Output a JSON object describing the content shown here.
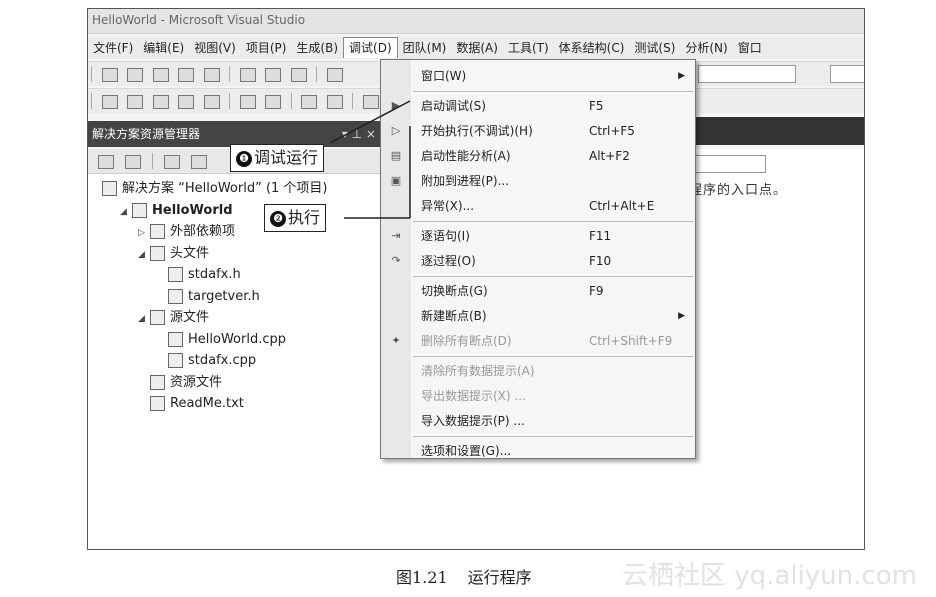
{
  "window": {
    "title": "HelloWorld - Microsoft Visual Studio"
  },
  "menubar": {
    "items": [
      "文件(F)",
      "编辑(E)",
      "视图(V)",
      "项目(P)",
      "生成(B)",
      "调试(D)",
      "团队(M)",
      "数据(A)",
      "工具(T)",
      "体系结构(C)",
      "测试(S)",
      "分析(N)",
      "窗口"
    ]
  },
  "solution_explorer": {
    "title": "解决方案资源管理器",
    "pin": "▾ ⊥ ×",
    "tree": [
      {
        "label": "解决方案 “HelloWorld” (1 个项目)",
        "icon": "solution-icon",
        "indent": 0,
        "arrow": ""
      },
      {
        "label": "HelloWorld",
        "icon": "project-icon",
        "indent": 1,
        "arrow": "◢",
        "bold": true
      },
      {
        "label": "外部依赖项",
        "icon": "external-deps-icon",
        "indent": 2,
        "arrow": "▷"
      },
      {
        "label": "头文件",
        "icon": "folder-icon",
        "indent": 2,
        "arrow": "◢"
      },
      {
        "label": "stdafx.h",
        "icon": "header-file-icon",
        "indent": 3,
        "arrow": ""
      },
      {
        "label": "targetver.h",
        "icon": "header-file-icon",
        "indent": 3,
        "arrow": ""
      },
      {
        "label": "源文件",
        "icon": "folder-icon",
        "indent": 2,
        "arrow": "◢"
      },
      {
        "label": "HelloWorld.cpp",
        "icon": "cpp-file-icon",
        "indent": 3,
        "arrow": ""
      },
      {
        "label": "stdafx.cpp",
        "icon": "cpp-file-icon",
        "indent": 3,
        "arrow": ""
      },
      {
        "label": "资源文件",
        "icon": "folder-icon",
        "indent": 2,
        "arrow": ""
      },
      {
        "label": "ReadMe.txt",
        "icon": "text-file-icon",
        "indent": 2,
        "arrow": ""
      }
    ]
  },
  "editor": {
    "text": "程序的入口点。"
  },
  "debug_menu": {
    "items": [
      {
        "label": "窗口(W)",
        "shortcut": "",
        "submenu": true,
        "icon": "",
        "disabled": false
      },
      {
        "sep": true
      },
      {
        "label": "启动调试(S)",
        "shortcut": "F5",
        "icon": "▶",
        "disabled": false
      },
      {
        "label": "开始执行(不调试)(H)",
        "shortcut": "Ctrl+F5",
        "icon": "▷",
        "disabled": false
      },
      {
        "label": "启动性能分析(A)",
        "shortcut": "Alt+F2",
        "icon": "▤",
        "disabled": false
      },
      {
        "label": "附加到进程(P)...",
        "shortcut": "",
        "icon": "▣",
        "disabled": false
      },
      {
        "label": "异常(X)...",
        "shortcut": "Ctrl+Alt+E",
        "icon": "",
        "disabled": false
      },
      {
        "sep": true
      },
      {
        "label": "逐语句(I)",
        "shortcut": "F11",
        "icon": "⇥",
        "disabled": false
      },
      {
        "label": "逐过程(O)",
        "shortcut": "F10",
        "icon": "↷",
        "disabled": false
      },
      {
        "sep": true
      },
      {
        "label": "切换断点(G)",
        "shortcut": "F9",
        "icon": "",
        "disabled": false
      },
      {
        "label": "新建断点(B)",
        "shortcut": "",
        "submenu": true,
        "icon": "",
        "disabled": false
      },
      {
        "label": "删除所有断点(D)",
        "shortcut": "Ctrl+Shift+F9",
        "icon": "✦",
        "disabled": true
      },
      {
        "sep": true
      },
      {
        "label": "清除所有数据提示(A)",
        "shortcut": "",
        "icon": "",
        "disabled": true
      },
      {
        "label": "导出数据提示(X) ...",
        "shortcut": "",
        "icon": "",
        "disabled": true
      },
      {
        "label": "导入数据提示(P) ...",
        "shortcut": "",
        "icon": "",
        "disabled": false
      },
      {
        "sep": true
      },
      {
        "label": "选项和设置(G)...",
        "shortcut": "",
        "icon": "",
        "disabled": false
      }
    ]
  },
  "callouts": {
    "one": {
      "num": "❶",
      "text": "调试运行"
    },
    "two": {
      "num": "❷",
      "text": "执行"
    }
  },
  "caption": {
    "fig": "图1.21",
    "text": "运行程序"
  },
  "watermark": "云栖社区 yq.aliyun.com"
}
